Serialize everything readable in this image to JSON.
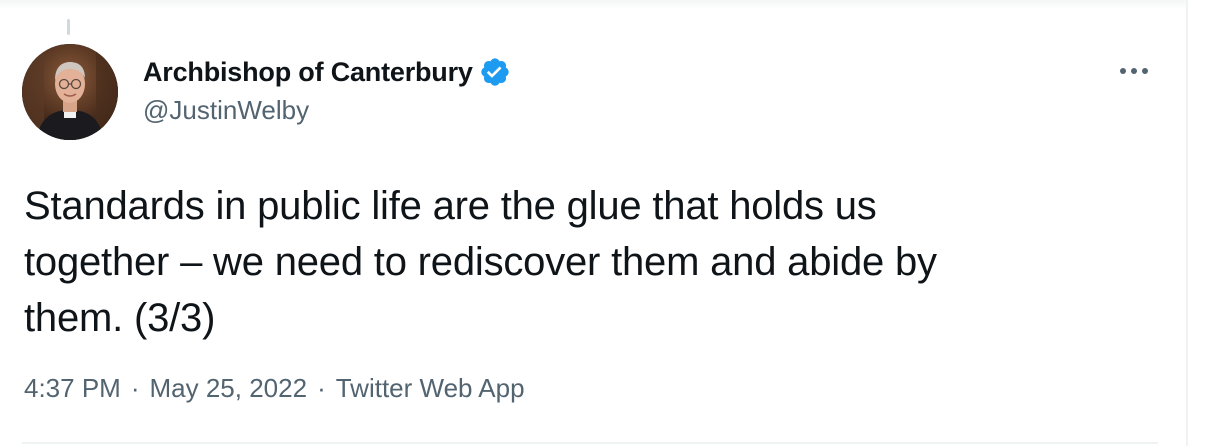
{
  "tweet": {
    "author": {
      "display_name": "Archbishop of Canterbury",
      "handle": "@JustinWelby",
      "verified": true,
      "verified_icon": "verified-badge-icon",
      "verified_color": "#1d9bf0",
      "avatar": "profile-photo"
    },
    "text": "Standards in public life are the glue that holds us\ntogether – we need to rediscover them and abide by\nthem. (3/3)",
    "meta": {
      "time": "4:37 PM",
      "date": "May 25, 2022",
      "source": "Twitter Web App",
      "separator": "·"
    },
    "more_icon": "more-horizontal-icon"
  },
  "colors": {
    "text_primary": "#0f1419",
    "text_secondary": "#536471",
    "divider": "#eff3f4"
  }
}
